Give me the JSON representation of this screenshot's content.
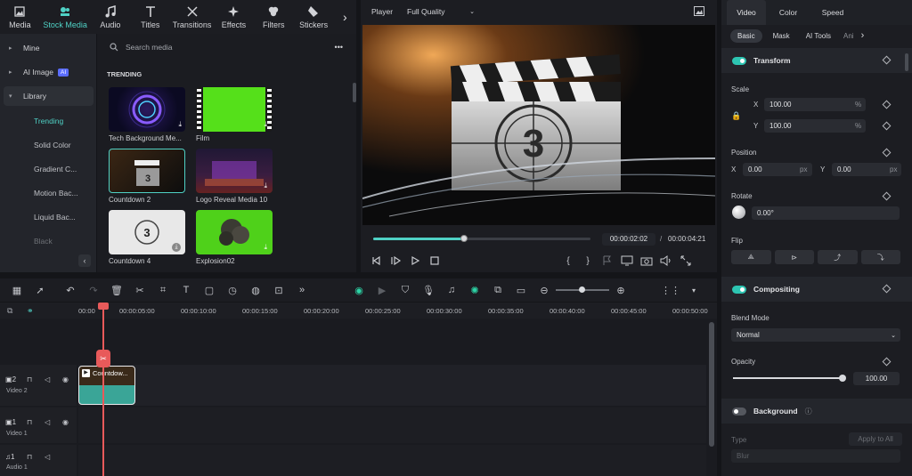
{
  "top_tabs": [
    {
      "label": "Media",
      "icon": "media-icon"
    },
    {
      "label": "Stock Media",
      "icon": "stock-media-icon"
    },
    {
      "label": "Audio",
      "icon": "audio-icon"
    },
    {
      "label": "Titles",
      "icon": "titles-icon"
    },
    {
      "label": "Transitions",
      "icon": "transitions-icon"
    },
    {
      "label": "Effects",
      "icon": "effects-icon"
    },
    {
      "label": "Filters",
      "icon": "filters-icon"
    },
    {
      "label": "Stickers",
      "icon": "stickers-icon"
    }
  ],
  "left_nav": {
    "items": [
      "Mine",
      "AI Image",
      "Library"
    ],
    "ai_badge": "AI",
    "library_sub": [
      "Trending",
      "Solid Color",
      "Gradient C...",
      "Motion Bac...",
      "Liquid Bac...",
      "Black"
    ]
  },
  "media": {
    "search_placeholder": "Search media",
    "more": "•••",
    "section": "TRENDING",
    "items": [
      "Tech Background Me...",
      "Film",
      "Countdown 2",
      "Logo Reveal Media 10",
      "Countdown 4",
      "Explosion02"
    ]
  },
  "player": {
    "label": "Player",
    "quality": "Full Quality",
    "current_time": "00:00:02:02",
    "separator": "/",
    "total_time": "00:00:04:21",
    "progress": 0.42,
    "countdown_number": "3"
  },
  "right_panel": {
    "tabs": [
      "Video",
      "Color",
      "Speed"
    ],
    "subtabs": [
      "Basic",
      "Mask",
      "AI Tools",
      "Ani"
    ],
    "transform": "Transform",
    "scale": "Scale",
    "scale_x_label": "X",
    "scale_x": "100.00",
    "scale_y_label": "Y",
    "scale_y": "100.00",
    "percent": "%",
    "position": "Position",
    "pos_x_label": "X",
    "pos_x": "0.00",
    "pos_y_label": "Y",
    "pos_y": "0.00",
    "px": "px",
    "rotate": "Rotate",
    "rotate_value": "0.00°",
    "flip": "Flip",
    "compositing": "Compositing",
    "blend_mode": "Blend Mode",
    "blend_value": "Normal",
    "opacity": "Opacity",
    "opacity_value": "100.00",
    "opacity_level": 1.0,
    "background": "Background",
    "type": "Type",
    "apply_all": "Apply to All",
    "blur": "Blur"
  },
  "timeline": {
    "ruler": [
      "00:00",
      "00:00:05:00",
      "00:00:10:00",
      "00:00:15:00",
      "00:00:20:00",
      "00:00:25:00",
      "00:00:30:00",
      "00:00:35:00",
      "00:00:40:00",
      "00:00:45:00",
      "00:00:50:00"
    ],
    "tracks": [
      {
        "num": "2",
        "name": "Video 2"
      },
      {
        "num": "1",
        "name": "Video 1"
      },
      {
        "num": "1",
        "name": "Audio 1"
      }
    ],
    "clip_label": "Countdow..."
  },
  "colors": {
    "accent": "#4fd1c5",
    "playhead": "#e85a5a",
    "clip": "#3aa597"
  }
}
